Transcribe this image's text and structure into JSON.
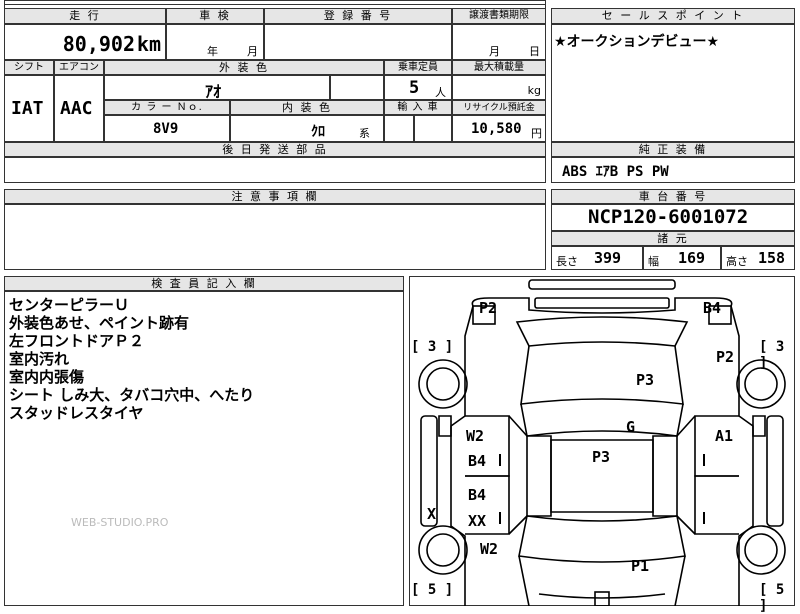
{
  "top": {
    "mileage_header": "走 行",
    "mileage_value": "80,902",
    "mileage_unit": "km",
    "inspection_header": "車 検",
    "inspection_year": "年",
    "inspection_month": "月",
    "reg_header": "登 録 番 号",
    "transfer_header": "譲渡書類期限",
    "transfer_month": "月",
    "transfer_day": "日",
    "shift_header": "シフト",
    "ac_header": "エアコン",
    "shift_value": "IAT",
    "ac_value": "AAC",
    "ext_color_header": "外 装 色",
    "ext_color_value": "ｱｵ",
    "capacity_header": "乗車定員",
    "capacity_value": "5",
    "capacity_unit": "人",
    "maxload_header": "最大積載量",
    "maxload_unit": "kg",
    "colorno_header": "カ ラ ー Ｎｏ.",
    "colorno_value": "8V9",
    "int_color_header": "内 装 色",
    "int_color_value": "ｸﾛ",
    "int_color_suffix": "系",
    "import_header": "輸 入 車",
    "recycle_header": "リサイクル預託金",
    "recycle_value": "10,580",
    "recycle_unit": "円",
    "later_parts_header": "後 日 発 送 部 品"
  },
  "sales": {
    "header": "セ ー ル ス ポ イ ン ト",
    "text": "★オークションデビュー★"
  },
  "equipment": {
    "header": "純 正 装 備",
    "text": "ABS ｴｱB PS PW"
  },
  "notes": {
    "header": "注 意 事 項 欄"
  },
  "chassis": {
    "header": "車 台 番 号",
    "value": "NCP120-6001072"
  },
  "specs": {
    "header": "諸 元",
    "length_label": "長さ",
    "length_value": "399",
    "width_label": "幅",
    "width_value": "169",
    "height_label": "高さ",
    "height_value": "158"
  },
  "inspector": {
    "header": "検 査 員 記 入 欄",
    "lines": [
      "センターピラーＵ",
      "外装色あせ、ペイント跡有",
      "左フロントドアＰ２",
      "室内汚れ",
      "室内内張傷",
      "シート しみ大、タバコ穴中、へたり",
      "スタッドレスタイヤ"
    ]
  },
  "watermark": "WEB-STUDIO.PRO",
  "diagram": {
    "marks": {
      "p2_left": "P2",
      "b4_right": "B4",
      "bracket_top_left": "[ 3 ]",
      "p2_right": "P2",
      "bracket_top_right": "[ 3 ]",
      "p3_top": "P3",
      "g": "G",
      "w2_left_top": "W2",
      "a1": "A1",
      "b4_left_top": "B4",
      "p3_mid": "P3",
      "b4_left_mid": "B4",
      "x_left": "X",
      "xx": "XX",
      "w2_left_bottom": "W2",
      "p1": "P1",
      "bracket_bottom_left": "[ 5 ]",
      "bracket_bottom_right": "[ 5 ]"
    }
  }
}
